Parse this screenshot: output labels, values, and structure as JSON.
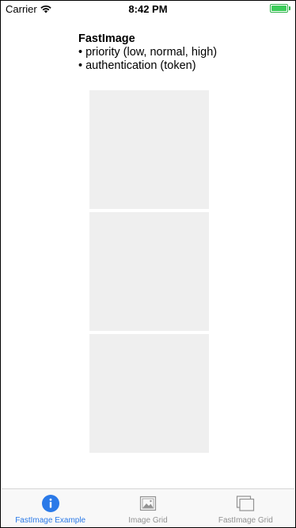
{
  "status_bar": {
    "carrier": "Carrier",
    "time": "8:42 PM"
  },
  "intro": {
    "title": "FastImage",
    "bullets": [
      "• priority (low, normal, high)",
      "• authentication (token)"
    ]
  },
  "images": [
    {
      "state": "loading"
    },
    {
      "state": "loading"
    },
    {
      "state": "loading"
    }
  ],
  "tab_bar": {
    "active_color": "#2b7ae8",
    "inactive_color": "#929292",
    "tabs": [
      {
        "label": "FastImage Example",
        "icon": "info-icon",
        "active": true
      },
      {
        "label": "Image Grid",
        "icon": "image-icon",
        "active": false
      },
      {
        "label": "FastImage Grid",
        "icon": "gallery-icon",
        "active": false
      }
    ]
  }
}
